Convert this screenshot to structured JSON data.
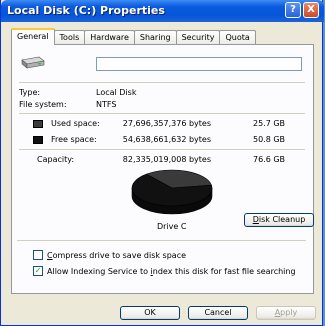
{
  "window": {
    "title": "Local Disk (C:) Properties",
    "help_glyph": "?",
    "close_glyph": "X"
  },
  "tabs": [
    {
      "label": "General",
      "active": true
    },
    {
      "label": "Tools"
    },
    {
      "label": "Hardware"
    },
    {
      "label": "Sharing"
    },
    {
      "label": "Security"
    },
    {
      "label": "Quota"
    }
  ],
  "general": {
    "drive_label_value": "",
    "type_label": "Type:",
    "type_value": "Local Disk",
    "fs_label": "File system:",
    "fs_value": "NTFS",
    "used_label": "Used space:",
    "used_bytes": "27,696,357,376 bytes",
    "used_gb": "25.7 GB",
    "free_label": "Free space:",
    "free_bytes": "54,638,661,632 bytes",
    "free_gb": "50.8 GB",
    "capacity_label": "Capacity:",
    "capacity_bytes": "82,335,019,008 bytes",
    "capacity_gb": "76.6 GB",
    "drive_name": "Drive C",
    "cleanup_button_pre": "",
    "cleanup_button_u": "D",
    "cleanup_button_post": "isk Cleanup",
    "compress_pre": "",
    "compress_u": "C",
    "compress_post": "ompress drive to save disk space",
    "compress_checked": false,
    "index_pre": "Allow Indexing Service to ",
    "index_u": "i",
    "index_post": "ndex this disk for fast file searching",
    "index_checked": true
  },
  "colors": {
    "used": "#3a3a3a",
    "free": "#111111"
  },
  "chart_data": {
    "type": "pie",
    "categories": [
      "Used space",
      "Free space"
    ],
    "values": [
      25.7,
      50.8
    ]
  },
  "buttons": {
    "ok": "OK",
    "cancel": "Cancel",
    "apply_u": "A",
    "apply_post": "pply"
  }
}
